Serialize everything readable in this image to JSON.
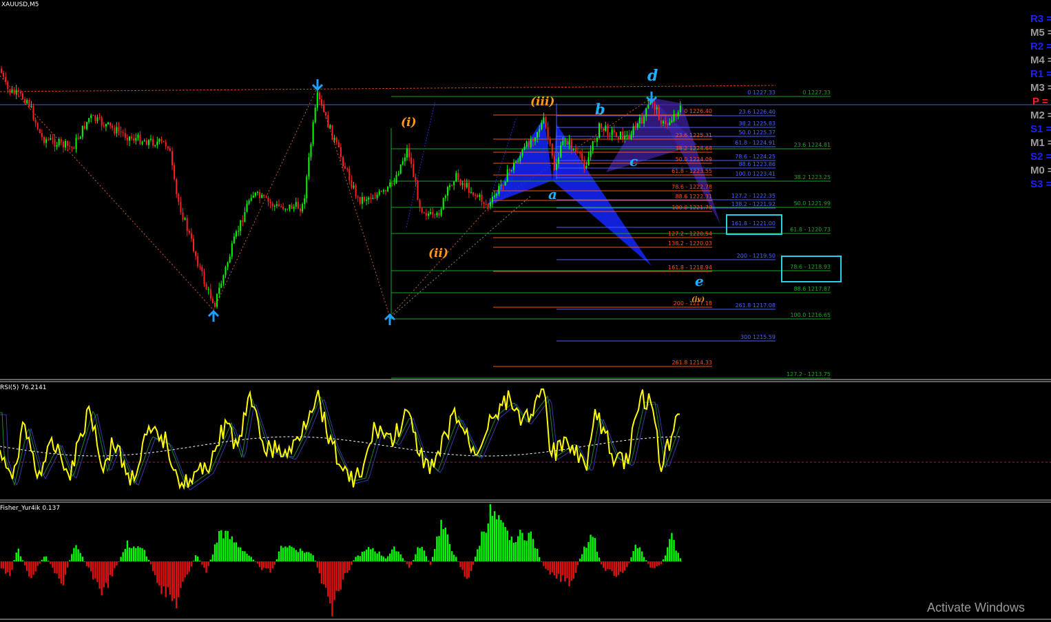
{
  "symbol_label": "XAUUSD,M5",
  "rsi_label": "RSI(5) 76.2141",
  "fisher_label": "Fisher_Yur4ik 0.137",
  "watermark": "Activate Windows",
  "colors": {
    "bull": "#00ff00",
    "bear": "#ff2020",
    "rsi": "#ffff00",
    "pivot_r": "#1a22ff",
    "pivot_m": "#9a9a9a",
    "pivot_p": "#ff2020",
    "wave_orange": "#ff9a1a",
    "wave_blue": "#1fb1ff",
    "fib_blue": "#3050ff",
    "fib_red": "#ff4000",
    "fib_green": "#10a020",
    "highlight": "#27d3e6"
  },
  "pivots": [
    {
      "label": "R3 =",
      "kind": "r"
    },
    {
      "label": "M5 =",
      "kind": "m"
    },
    {
      "label": "R2 =",
      "kind": "r"
    },
    {
      "label": "M4 =",
      "kind": "m"
    },
    {
      "label": "R1 =",
      "kind": "r"
    },
    {
      "label": "M3 =",
      "kind": "m"
    },
    {
      "label": "P =",
      "kind": "p"
    },
    {
      "label": "M2 =",
      "kind": "m"
    },
    {
      "label": "S1 =",
      "kind": "r"
    },
    {
      "label": "M1 =",
      "kind": "m"
    },
    {
      "label": "S2 =",
      "kind": "r"
    },
    {
      "label": "M0 =",
      "kind": "m"
    },
    {
      "label": "S3 =",
      "kind": "r"
    }
  ],
  "wave_labels": {
    "i": "(i)",
    "ii": "(ii)",
    "iii": "(iii)",
    "iv": "(iv)",
    "a": "a",
    "b": "b",
    "c": "c",
    "d": "d",
    "e": "e"
  },
  "fib_blue": [
    "0 1227.33",
    "23.6 1226.40",
    "38.2 1225.83",
    "50.0 1225.37",
    "61.8 - 1224.91",
    "78.6 - 1224.25",
    "88.6 1223.86",
    "100.0 1223.41",
    "127.2 - 1222.35",
    "138.2 - 1221.92",
    "161.8 - 1221.00",
    "200 - 1219.50",
    "261.8 1217.08",
    "300 1215.59"
  ],
  "fib_red": [
    "0 1226.40",
    "23.6 1225.31",
    "38.2 1224.64",
    "50.0 1224.09",
    "61.8 - 1223.55",
    "78.6 - 1222.78",
    "88.6 1222.31",
    "100.0 1221.79",
    "127.2 - 1220.54",
    "138.2 - 1220.03",
    "161.8 - 1218.94",
    "200 - 1217.18",
    "261.8 1214.33"
  ],
  "fib_green": [
    "0 1227.33",
    "23.6 1224.81",
    "38.2 1223.25",
    "50.0 1221.99",
    "61.8 - 1220.73",
    "78.6 - 1218.93",
    "88.6 1217.87",
    "100.0 1216.65",
    "127.2 - 1213.75"
  ]
}
